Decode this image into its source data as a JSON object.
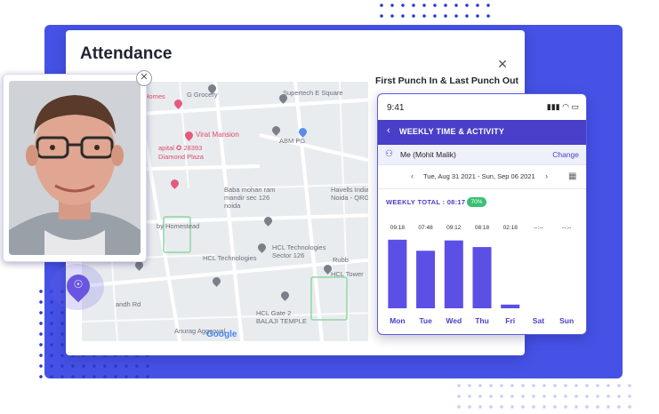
{
  "card": {
    "title": "Attendance"
  },
  "map": {
    "labels": [
      {
        "text": "Homes",
        "red": true
      },
      {
        "text": "G Grocery",
        "red": false
      },
      {
        "text": "Supertech E Square",
        "red": false
      },
      {
        "text": "Virat Mansion",
        "red": true
      },
      {
        "text": "apital ✪ 28393",
        "red": true
      },
      {
        "text": "Diamond Plaza",
        "red": true
      },
      {
        "text": "ABM PG",
        "red": false
      },
      {
        "text": "Baba mohan ram mandir sec 126 noida",
        "red": false
      },
      {
        "text": "Havells India Noida - QRG",
        "red": false
      },
      {
        "text": "by Homestead",
        "red": false
      },
      {
        "text": "HCL Technologies",
        "red": false
      },
      {
        "text": "HCL Technologies Sector 126",
        "red": false
      },
      {
        "text": "Rubb",
        "red": false
      },
      {
        "text": "HCL Tower",
        "red": false
      },
      {
        "text": "andh Rd",
        "red": false
      },
      {
        "text": "HCL Gate 2",
        "red": false
      },
      {
        "text": "BALAJI TEMPLE",
        "red": false
      },
      {
        "text": "Anurag Aggarwal",
        "red": false
      }
    ],
    "attribution": "Google"
  },
  "panel": {
    "title": "First Punch In & Last Punch Out",
    "close_icon": "close-icon"
  },
  "phone": {
    "status_time": "9:41",
    "header_title": "WEEKLY TIME & ACTIVITY",
    "user_name": "Me (Mohit Malik)",
    "change_label": "Change",
    "date_range": "Tue, Aug 31 2021 - Sun, Sep 06 2021",
    "weekly_total_label": "WEEKLY TOTAL :",
    "weekly_total_value": "08:17",
    "badge": "70%"
  },
  "chart_data": {
    "type": "bar",
    "categories": [
      "Mon",
      "Tue",
      "Wed",
      "Thu",
      "Fri",
      "Sat",
      "Sun"
    ],
    "values": [
      9.3,
      7.8,
      9.2,
      8.3,
      0.5,
      0,
      0
    ],
    "value_labels": [
      "09:18",
      "07:48",
      "09:12",
      "08:18",
      "02:18",
      "--:--",
      "--:--"
    ],
    "ylim": [
      0,
      10
    ],
    "color": "#5b4fe6"
  },
  "colors": {
    "backdrop": "#4652e6",
    "accent": "#4a3fc8",
    "badge": "#38c172"
  }
}
